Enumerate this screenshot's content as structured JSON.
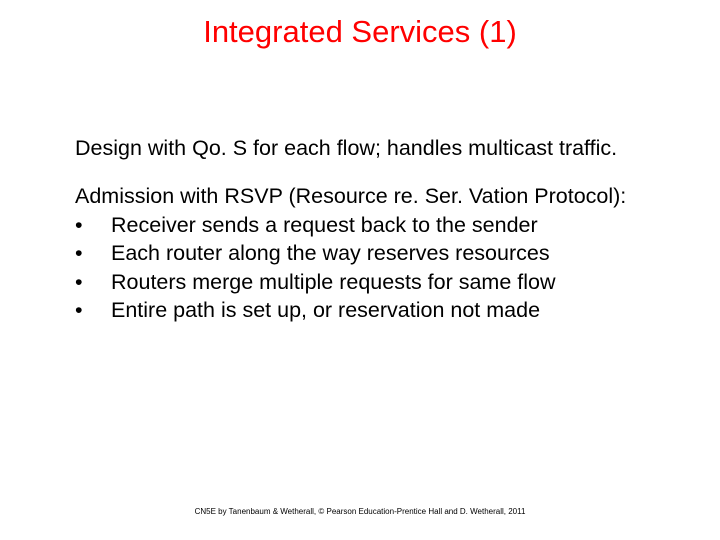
{
  "title": "Integrated Services (1)",
  "section1": "Design with Qo. S for each flow; handles multicast traffic.",
  "section2_intro": "Admission with RSVP (Resource re. Ser. Vation Protocol):",
  "bullets": {
    "b0": "Receiver sends a request back to the sender",
    "b1": "Each router along the way reserves resources",
    "b2": "Routers merge multiple requests for same flow",
    "b3": "Entire path is set up, or reservation not made"
  },
  "bullet_symbol": "•",
  "footer": "CN5E by Tanenbaum & Wetherall, © Pearson Education-Prentice Hall and D. Wetherall, 2011"
}
